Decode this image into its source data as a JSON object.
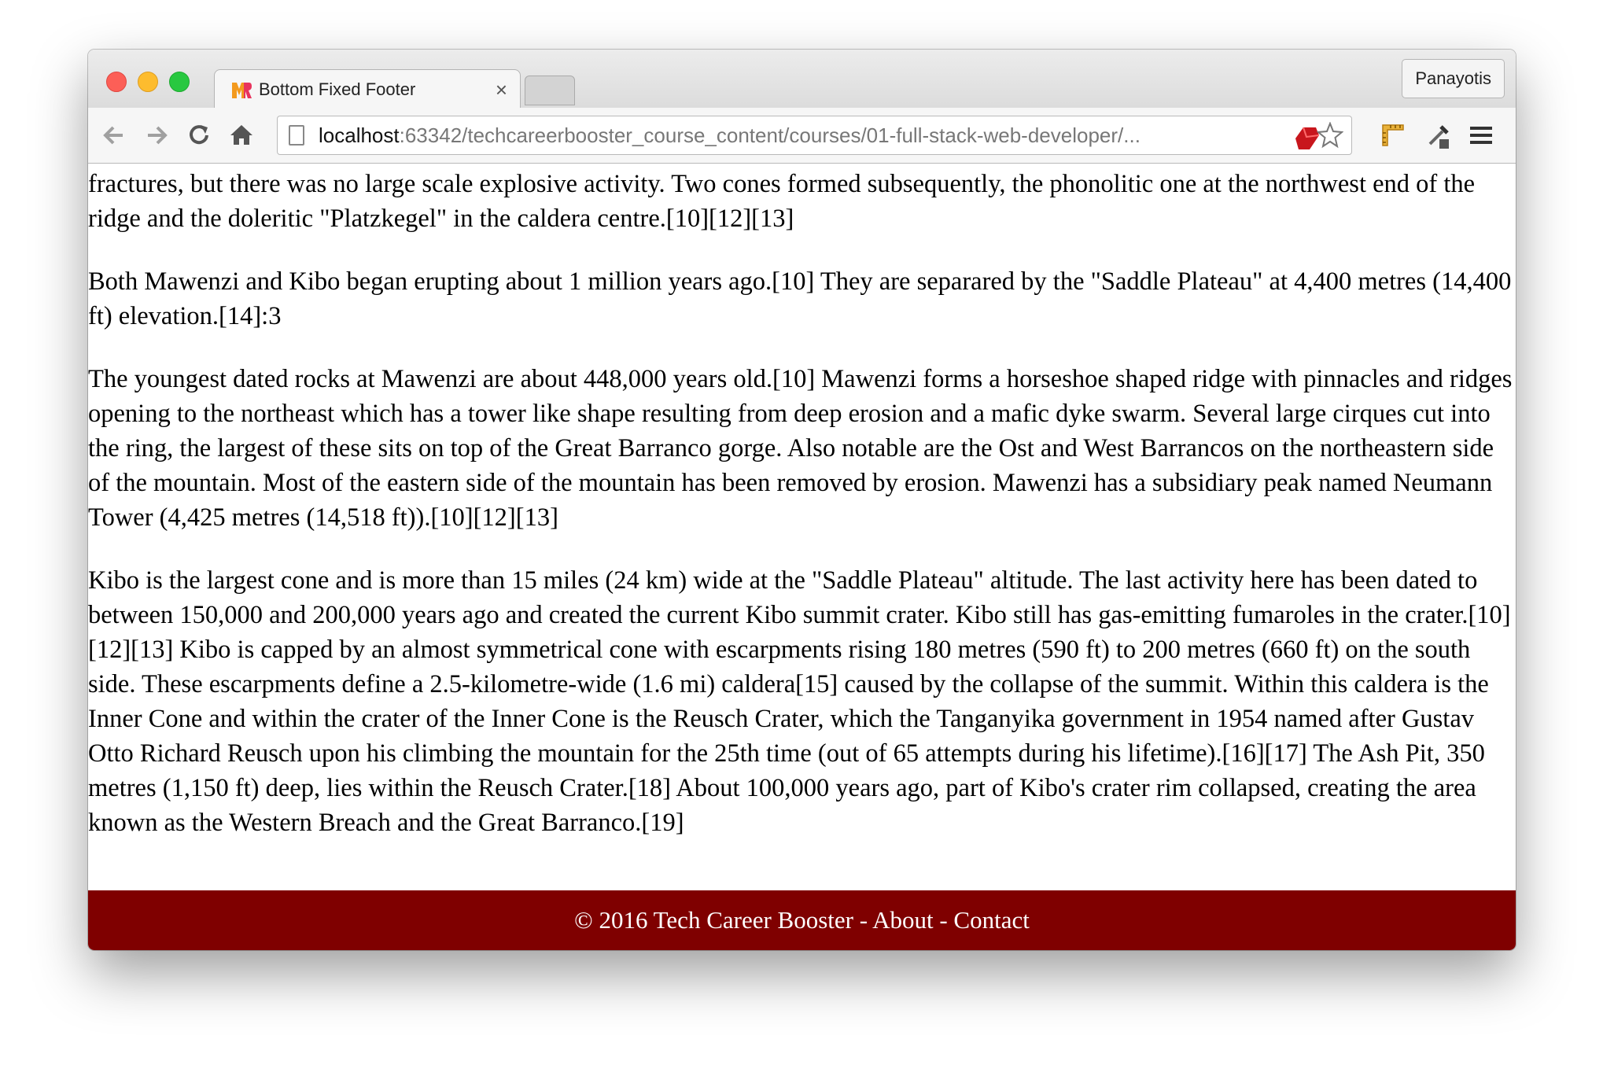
{
  "window": {
    "tab_title": "Bottom Fixed Footer",
    "tab_close": "×",
    "profile_name": "Panayotis"
  },
  "toolbar": {
    "back_icon": "back-arrow-icon",
    "forward_icon": "forward-arrow-icon",
    "reload_icon": "reload-icon",
    "home_icon": "home-icon",
    "address_host": "localhost",
    "address_rest": ":63342/techcareerbooster_course_content/courses/01-full-stack-web-developer/..."
  },
  "content": {
    "paragraphs": [
      "mostly composed of basic lavas with some pyroclastics. The formation of the caldera was accompanied by lava emanating from ring fractures, but there was no large scale explosive activity. Two cones formed subsequently, the phonolitic one at the northwest end of the ridge and the doleritic \"Platzkegel\" in the caldera centre.[10][12][13]",
      "Both Mawenzi and Kibo began erupting about 1 million years ago.[10] They are separared by the \"Saddle Plateau\" at 4,400 metres (14,400 ft) elevation.[14]:3",
      "The youngest dated rocks at Mawenzi are about 448,000 years old.[10] Mawenzi forms a horseshoe shaped ridge with pinnacles and ridges opening to the northeast which has a tower like shape resulting from deep erosion and a mafic dyke swarm. Several large cirques cut into the ring, the largest of these sits on top of the Great Barranco gorge. Also notable are the Ost and West Barrancos on the northeastern side of the mountain. Most of the eastern side of the mountain has been removed by erosion. Mawenzi has a subsidiary peak named Neumann Tower (4,425 metres (14,518 ft)).[10][12][13]",
      "Kibo is the largest cone and is more than 15 miles (24 km) wide at the \"Saddle Plateau\" altitude. The last activity here has been dated to between 150,000 and 200,000 years ago and created the current Kibo summit crater. Kibo still has gas-emitting fumaroles in the crater.[10][12][13] Kibo is capped by an almost symmetrical cone with escarpments rising 180 metres (590 ft) to 200 metres (660 ft) on the south side. These escarpments define a 2.5-kilometre-wide (1.6 mi) caldera[15] caused by the collapse of the summit. Within this caldera is the Inner Cone and within the crater of the Inner Cone is the Reusch Crater, which the Tanganyika government in 1954 named after Gustav Otto Richard Reusch upon his climbing the mountain for the 25th time (out of 65 attempts during his lifetime).[16][17] The Ash Pit, 350 metres (1,150 ft) deep, lies within the Reusch Crater.[18] About 100,000 years ago, part of Kibo's crater rim collapsed, creating the area known as the Western Breach and the Great Barranco.[19]"
    ]
  },
  "footer": {
    "copyright": "© 2016 Tech Career Booster - ",
    "about": "About",
    "separator": " - ",
    "contact": "Contact",
    "background": "#7f0000"
  }
}
